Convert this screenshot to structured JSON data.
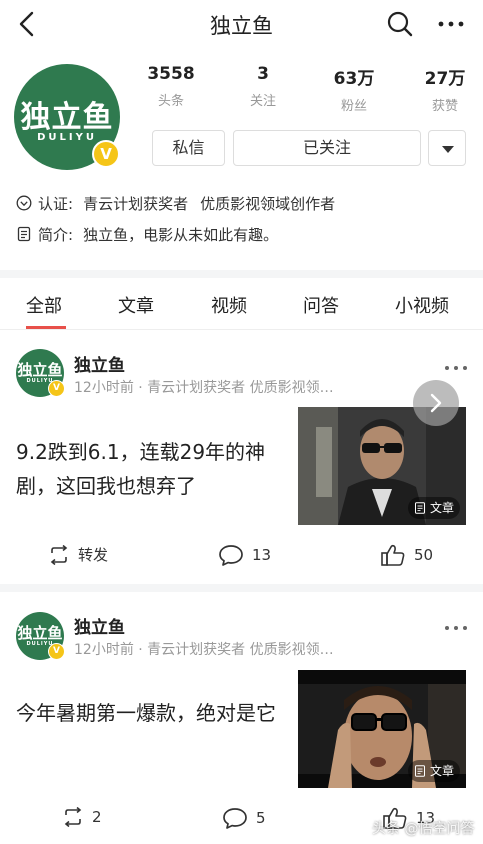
{
  "topnav": {
    "title": "独立鱼"
  },
  "profile": {
    "logo_cn": "独立鱼",
    "logo_en": "DULIYU",
    "badge": "V",
    "stats": [
      {
        "num": "3558",
        "label": "头条"
      },
      {
        "num": "3",
        "label": "关注"
      },
      {
        "num": "63万",
        "label": "粉丝"
      },
      {
        "num": "27万",
        "label": "获赞"
      }
    ],
    "message_btn": "私信",
    "follow_btn": "已关注",
    "cert_label": "认证:",
    "cert_value1": "青云计划获奖者",
    "cert_value2": "优质影视领域创作者",
    "intro_label": "简介:",
    "intro_value": "独立鱼，电影从未如此有趣。"
  },
  "tabs": [
    {
      "label": "全部",
      "active": true
    },
    {
      "label": "文章"
    },
    {
      "label": "视频"
    },
    {
      "label": "问答"
    },
    {
      "label": "小视频"
    }
  ],
  "posts": [
    {
      "author": "独立鱼",
      "avatar_cn": "独立鱼",
      "avatar_en": "DULIYU",
      "badge": "V",
      "meta": "12小时前 · 青云计划获奖者  优质影视领…",
      "headline": "9.2跌到6.1，连载29年的神剧，这回我也想弃了",
      "thumb_badge": "文章",
      "actions": {
        "share": "转发",
        "comments": "13",
        "likes": "50"
      }
    },
    {
      "author": "独立鱼",
      "avatar_cn": "独立鱼",
      "avatar_en": "DULIYU",
      "badge": "V",
      "meta": "12小时前 · 青云计划获奖者  优质影视领…",
      "headline": "今年暑期第一爆款，绝对是它",
      "thumb_badge": "文章",
      "actions": {
        "share": "2",
        "comments": "5",
        "likes": "13"
      }
    }
  ],
  "watermark": "头条 @悟空问答",
  "colors": {
    "brand_green": "#2f7a4f",
    "accent_red": "#e8504a",
    "verified_yellow": "#f5c518"
  }
}
